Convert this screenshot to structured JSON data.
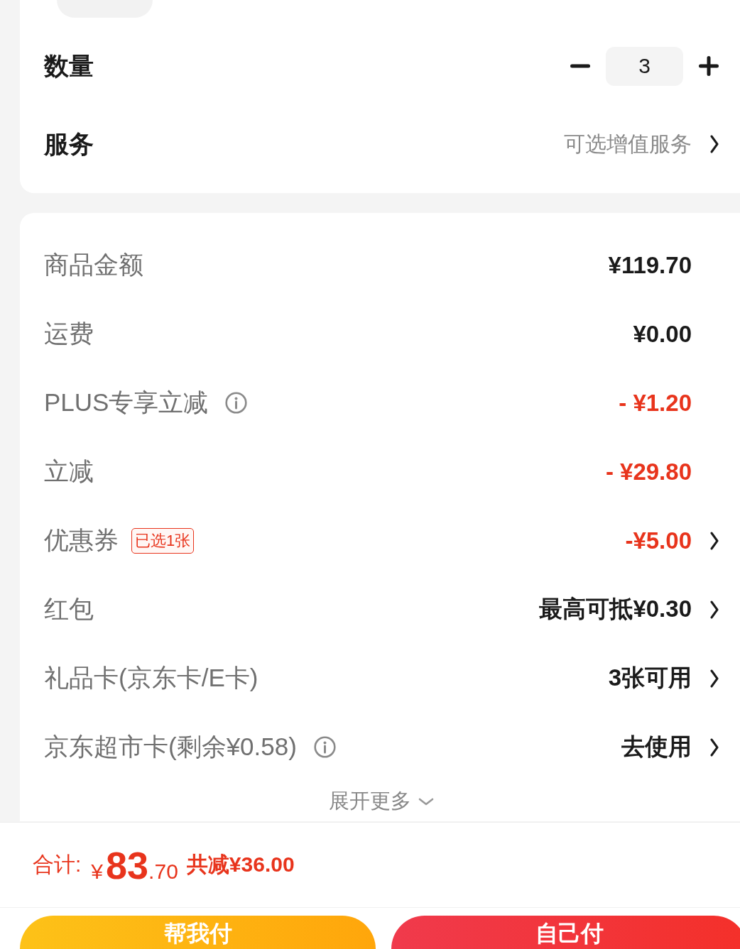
{
  "product_card": {
    "quantity": {
      "label": "数量",
      "value": "3"
    },
    "service": {
      "label": "服务",
      "value": "可选增值服务"
    }
  },
  "price_card": {
    "rows": [
      {
        "label": "商品金额",
        "kind": "amount",
        "value": "¥119.70",
        "info_icon": false,
        "chevron": false
      },
      {
        "label": "运费",
        "kind": "amount",
        "value": "¥0.00",
        "info_icon": false,
        "chevron": false
      },
      {
        "label": "PLUS专享立减",
        "kind": "discount",
        "value": "- ¥1.20",
        "info_icon": true,
        "chevron": false
      },
      {
        "label": "立减",
        "kind": "discount",
        "value": "- ¥29.80",
        "info_icon": false,
        "chevron": false
      },
      {
        "label": "优惠券",
        "badge": "已选1张",
        "kind": "discount",
        "value": "-¥5.00",
        "info_icon": false,
        "chevron": true
      },
      {
        "label": "红包",
        "kind": "amount",
        "value": "最高可抵¥0.30",
        "info_icon": false,
        "chevron": true
      },
      {
        "label": "礼品卡(京东卡/E卡)",
        "kind": "amount",
        "value": "3张可用",
        "info_icon": false,
        "chevron": true
      },
      {
        "label": "京东超市卡(剩余¥0.58)",
        "kind": "amount",
        "value": "去使用",
        "info_icon": true,
        "chevron": true
      }
    ],
    "expand": {
      "label": "展开更多"
    }
  },
  "footer": {
    "total": {
      "label": "合计:",
      "currency": "¥",
      "integer": "83",
      "decimal": ".70",
      "saving": "共减¥36.00"
    },
    "buttons": [
      {
        "label": "帮我付",
        "kind": "secondary"
      },
      {
        "label": "自己付",
        "kind": "primary"
      }
    ]
  }
}
